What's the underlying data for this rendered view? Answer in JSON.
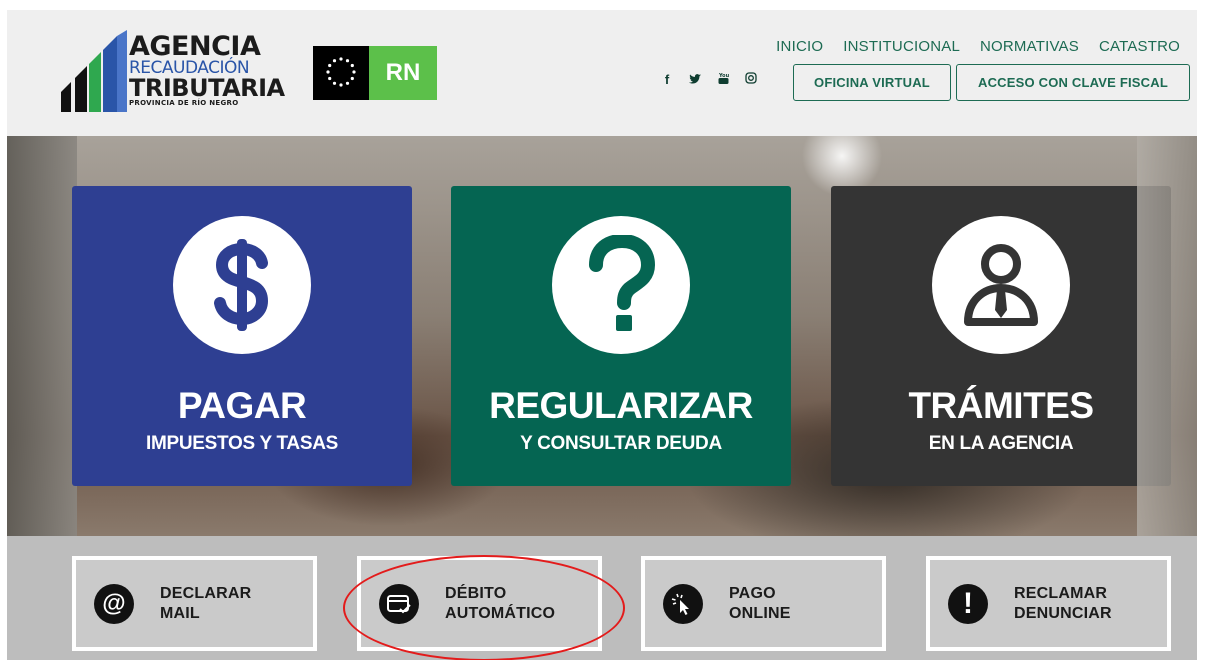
{
  "brand": {
    "line1": "AGENCIA",
    "line2": "RECAUDACIÓN",
    "line3": "TRIBUTARIA",
    "line4": "PROVINCIA DE RÍO NEGRO",
    "rn_badge": "RN"
  },
  "nav": {
    "items": [
      "INICIO",
      "INSTITUCIONAL",
      "NORMATIVAS",
      "CATASTRO"
    ]
  },
  "social": [
    "facebook-icon",
    "twitter-icon",
    "youtube-icon",
    "instagram-icon"
  ],
  "header_buttons": {
    "oficina_virtual": "OFICINA VIRTUAL",
    "clave_fiscal": "ACCESO CON CLAVE FISCAL"
  },
  "cards": [
    {
      "title": "PAGAR",
      "subtitle": "IMPUESTOS Y TASAS",
      "icon": "dollar-icon"
    },
    {
      "title": "REGULARIZAR",
      "subtitle": "Y CONSULTAR DEUDA",
      "icon": "question-icon"
    },
    {
      "title": "TRÁMITES",
      "subtitle": "EN LA AGENCIA",
      "icon": "person-icon"
    }
  ],
  "quick_links": [
    {
      "line1": "DECLARAR",
      "line2": "MAIL",
      "icon": "at-icon"
    },
    {
      "line1": "DÉBITO",
      "line2": "AUTOMÁTICO",
      "icon": "card-icon"
    },
    {
      "line1": "PAGO",
      "line2": "ONLINE",
      "icon": "cursor-click-icon"
    },
    {
      "line1": "RECLAMAR",
      "line2": "DENUNCIAR",
      "icon": "exclamation-icon"
    }
  ],
  "colors": {
    "blue": "#2e3f92",
    "green": "#056552",
    "dark": "#343434",
    "accent": "#1d6b53",
    "annotation": "#e31b1b"
  }
}
